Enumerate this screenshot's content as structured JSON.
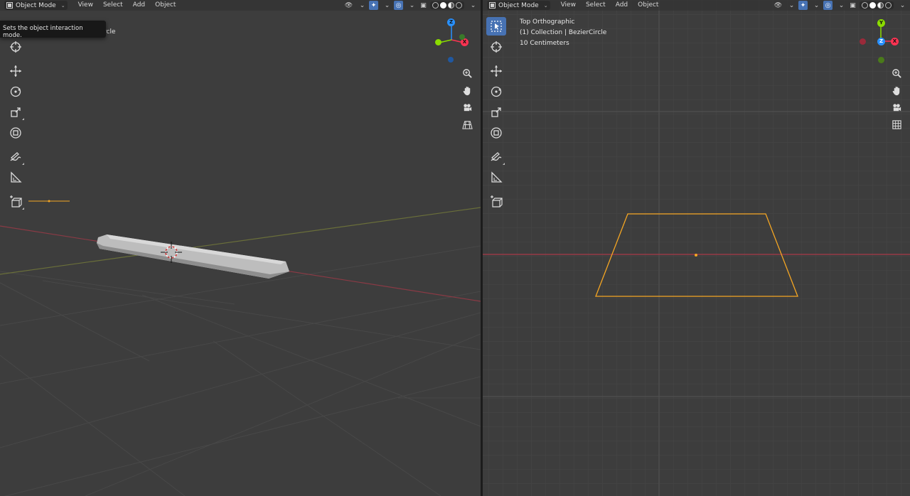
{
  "left_viewport": {
    "header": {
      "mode": "Object Mode",
      "menus": [
        "View",
        "Select",
        "Add",
        "Object"
      ]
    },
    "tooltip": "Sets the object interaction mode.",
    "obscured_info_fragment": "rcle",
    "gizmo": {
      "z": "Z",
      "x": "X"
    }
  },
  "right_viewport": {
    "header": {
      "mode": "Object Mode",
      "menus": [
        "View",
        "Select",
        "Add",
        "Object"
      ]
    },
    "info": {
      "view_name": "Top Orthographic",
      "collection": "(1) Collection | BezierCircle",
      "scale": "10 Centimeters"
    },
    "gizmo": {
      "y": "Y",
      "x": "X",
      "z": "Z"
    }
  },
  "colors": {
    "viewport_bg": "#3d3d3d",
    "active_tool": "#4772b3",
    "selection_orange": "#f5a623",
    "axis_x": "#ff3352",
    "axis_y": "#8bdc00",
    "axis_z": "#2890ff"
  },
  "icons": {
    "toolbar": [
      "select-box-icon",
      "cursor-icon",
      "move-icon",
      "rotate-icon",
      "scale-icon",
      "transform-icon",
      "annotate-icon",
      "measure-icon",
      "add-cube-icon"
    ],
    "nav": [
      "zoom-icon",
      "pan-hand-icon",
      "camera-icon",
      "grid-icon"
    ]
  }
}
